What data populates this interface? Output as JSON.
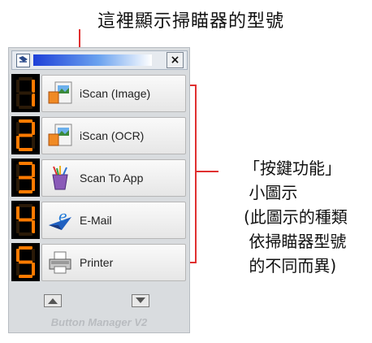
{
  "annotation_top": "這裡顯示掃瞄器的型號",
  "annotation_side": [
    "「按鍵功能」",
    " 小圖示",
    "(此圖示的種類",
    " 依掃瞄器型號",
    " 的不同而異)"
  ],
  "colors": {
    "accent_red": "#e03030",
    "lcd_orange": "#ff7a00"
  },
  "titlebar": {
    "close_label": "×",
    "app_icon": "scanner-icon"
  },
  "buttons": [
    {
      "number": "1",
      "label": "iScan (Image)",
      "icon": "image-scan-icon"
    },
    {
      "number": "2",
      "label": "iScan (OCR)",
      "icon": "ocr-scan-icon"
    },
    {
      "number": "3",
      "label": "Scan To App",
      "icon": "application-icon"
    },
    {
      "number": "4",
      "label": "E-Mail",
      "icon": "email-icon"
    },
    {
      "number": "5",
      "label": "Printer",
      "icon": "printer-icon"
    }
  ],
  "nav": {
    "up_icon": "scroll-up-icon",
    "down_icon": "scroll-down-icon"
  },
  "brand": "Button Manager V2"
}
